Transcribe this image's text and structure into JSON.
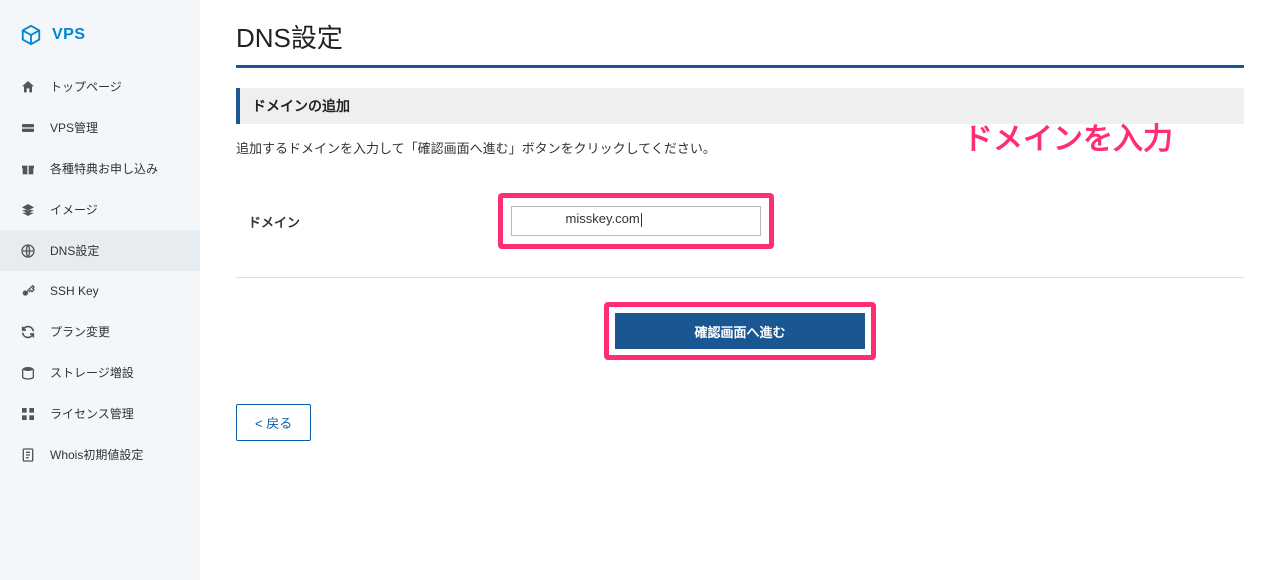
{
  "sidebar": {
    "logo": "VPS",
    "items": [
      {
        "label": "トップページ",
        "name": "home"
      },
      {
        "label": "VPS管理",
        "name": "vps"
      },
      {
        "label": "各種特典お申し込み",
        "name": "offers"
      },
      {
        "label": "イメージ",
        "name": "images"
      },
      {
        "label": "DNS設定",
        "name": "dns",
        "active": true
      },
      {
        "label": "SSH Key",
        "name": "sshkey"
      },
      {
        "label": "プラン変更",
        "name": "plan"
      },
      {
        "label": "ストレージ増設",
        "name": "storage"
      },
      {
        "label": "ライセンス管理",
        "name": "license"
      },
      {
        "label": "Whois初期値設定",
        "name": "whois"
      }
    ]
  },
  "main": {
    "page_title": "DNS設定",
    "section_header": "ドメインの追加",
    "instruction": "追加するドメインを入力して「確認画面へ進む」ボタンをクリックしてください。",
    "form_label": "ドメイン",
    "domain_value_visible": "misskey.com",
    "submit_label": "確認画面へ進む",
    "back_label": "< 戻る"
  },
  "annotations": {
    "input_hint": "ドメインを入力"
  }
}
